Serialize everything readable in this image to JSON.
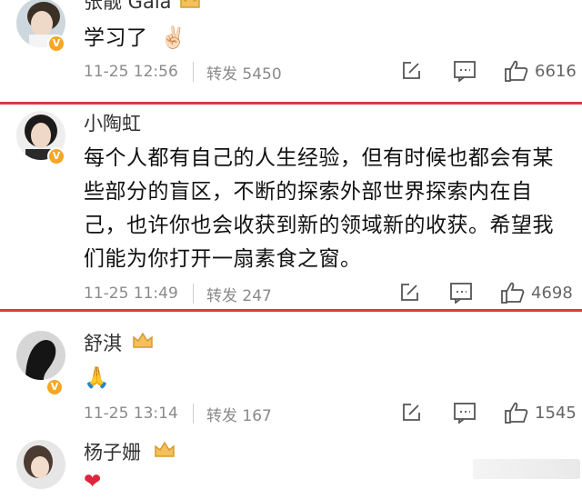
{
  "comments": [
    {
      "username": "张靓 Gala",
      "text": "学习了",
      "emoji": "✌🏻",
      "time": "11-25 12:56",
      "repost": "转发 5450",
      "likes": "6616"
    },
    {
      "username": "小陶虹",
      "text": "每个人都有自己的人生经验，但有时候也都会有某些部分的盲区，不断的探索外部世界探索内在自己，也许你也会收获到新的领域新的收获。希望我们能为你打开一扇素食之窗。",
      "time": "11-25 11:49",
      "repost": "转发 247",
      "likes": "4698"
    },
    {
      "username": "舒淇",
      "emoji": "🙏",
      "time": "11-25 13:14",
      "repost": "转发 167",
      "likes": "1545"
    },
    {
      "username": "杨子姗",
      "emoji": "❤"
    }
  ],
  "colors": {
    "highlight": "#d93b3b",
    "verified": "#f5a623",
    "meta": "#8a8a8a"
  },
  "icons": [
    "verified-badge-icon",
    "crown-badge-icon",
    "edit-icon",
    "comment-icon",
    "like-icon"
  ]
}
